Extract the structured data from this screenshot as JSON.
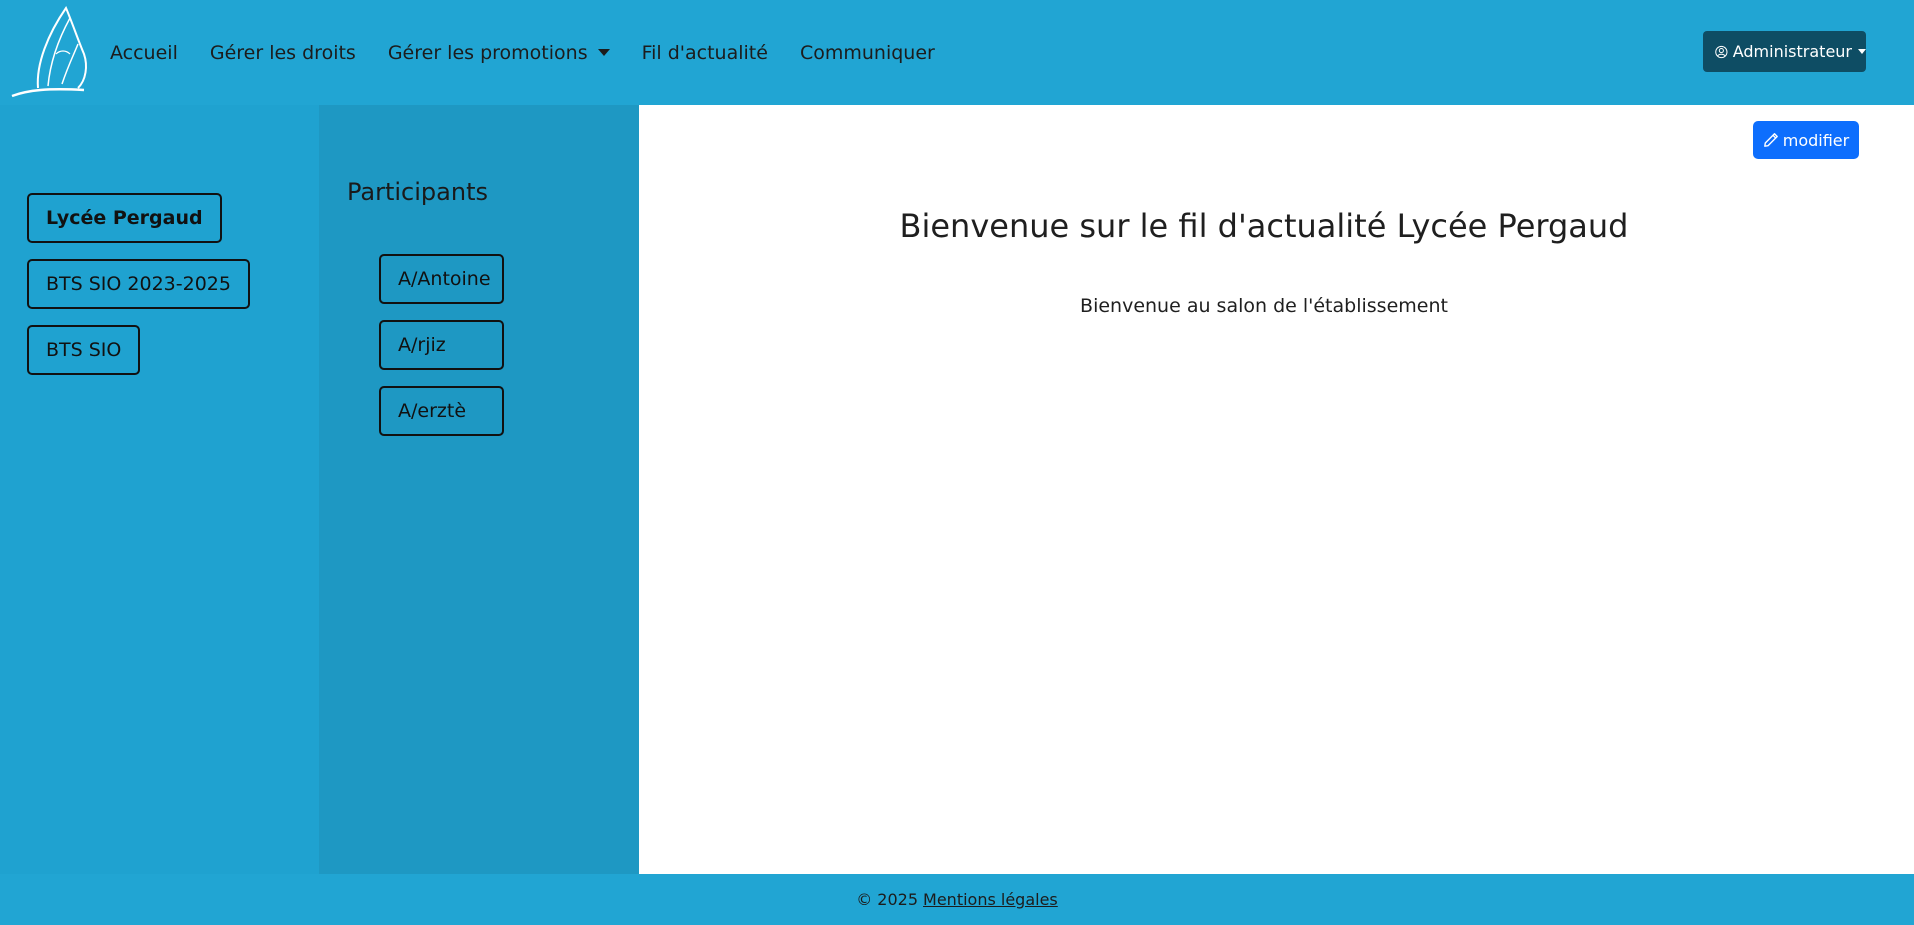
{
  "navbar": {
    "logo_icon": "praying-hands-logo",
    "links": [
      "Accueil",
      "Gérer les droits",
      "Gérer les promotions",
      "Fil d'actualité",
      "Communiquer"
    ],
    "user_menu": {
      "label": "Administrateur",
      "icon": "user-circle-icon"
    }
  },
  "channels": [
    "Lycée Pergaud",
    "BTS SIO 2023-2025",
    "BTS SIO"
  ],
  "participants": {
    "title": "Participants",
    "items": [
      "A/Antoine",
      "A/rjiz",
      "A/erztè"
    ]
  },
  "main": {
    "edit_label": "modifier",
    "edit_icon": "pencil-icon",
    "title": "Bienvenue sur le fil d'actualité Lycée Pergaud",
    "message": "Bienvenue au salon de l'établissement"
  },
  "footer": {
    "copyright": "© 2025",
    "legal_link": "Mentions légales"
  },
  "colors": {
    "nav_bg": "#21a5d3",
    "sidebar_left_bg": "#1fa2d0",
    "sidebar_mid_bg": "#1e98c3",
    "admin_bg": "#0e4d64",
    "edit_btn_bg": "#0d6efd"
  }
}
